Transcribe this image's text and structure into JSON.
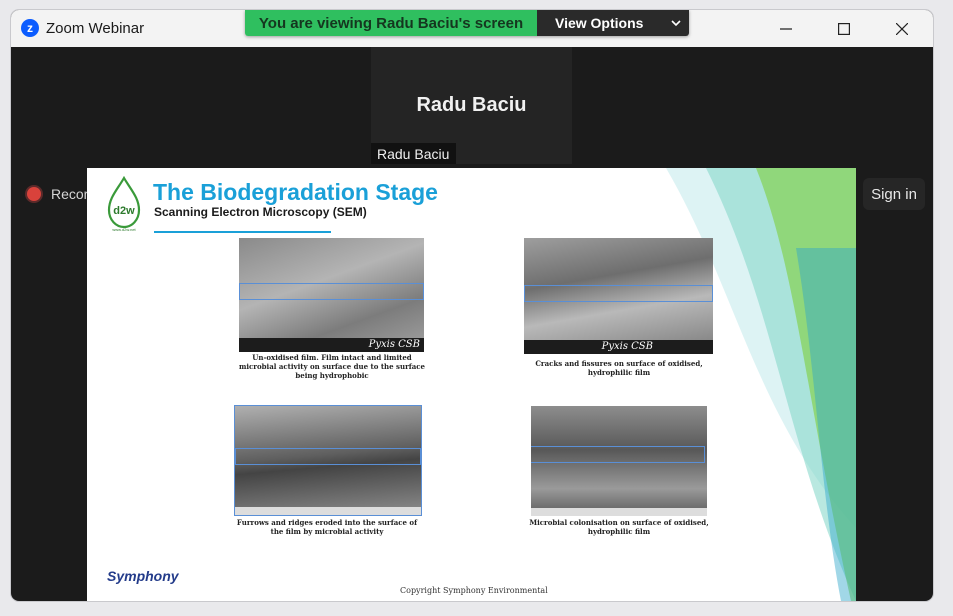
{
  "window": {
    "title": "Zoom Webinar"
  },
  "banner": {
    "viewing_text": "You are viewing Radu Baciu's screen",
    "view_options": "View Options"
  },
  "participant": {
    "tile_name": "Radu Baciu",
    "tile_label": "Radu Baciu"
  },
  "toolbar": {
    "recording_label": "Recor",
    "sign_in": "Sign in"
  },
  "slide": {
    "title": "The Biodegradation Stage",
    "subtitle": "Scanning Electron Microscopy (SEM)",
    "logo_text": "d2w",
    "logo_sub": "www.d2w.net",
    "image_labels": [
      "Pyxis CSB",
      "Pyxis CSB"
    ],
    "captions": [
      [
        "Un-oxidised film.  Film intact and limited",
        "microbial activity on surface due to the surface",
        "being hydrophobic"
      ],
      [
        "Cracks and fissures on surface of oxidised,",
        "hydrophilic film"
      ],
      [
        "Furrows and ridges eroded into the surface of",
        "the film by microbial activity"
      ],
      [
        "Microbial  colonisation on surface of oxidised,",
        "hydrophilic film"
      ]
    ],
    "footer_logo": "Symphony",
    "copyright": "Copyright Symphony Environmental"
  },
  "colors": {
    "banner_green": "#2fbf5f",
    "slide_title_blue": "#1aa0d8",
    "accent_green": "#7fcf3a"
  },
  "icons": [
    "zoom-logo-icon",
    "minimize-icon",
    "maximize-icon",
    "close-icon",
    "chevron-down-icon",
    "record-icon"
  ]
}
